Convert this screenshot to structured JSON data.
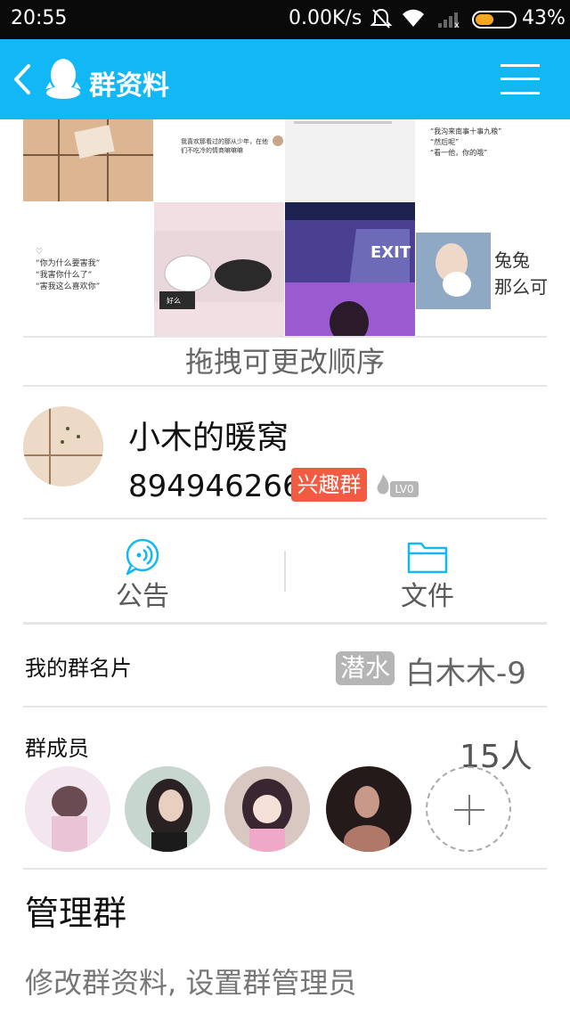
{
  "status_bar": {
    "time": "20:55",
    "net_speed": "0.00K/s",
    "battery_pct": "43%",
    "battery_level": 0.43
  },
  "title_bar": {
    "title": "群资料",
    "back_icon": "chevron-left-icon",
    "logo_icon": "qq-penguin-icon",
    "menu_icon": "hamburger-menu-icon"
  },
  "gallery": {
    "captions": [
      "",
      "我喜欢那看过的那从少年，在他\n们不吃冷的情商嘛嘛嘛",
      "",
      "“我沟来南事十事九粮”\n“然后呢”\n“看一他，你的哦”",
      "♡\n“你为什么要害我”\n“我害你什么了”\n“害我这么喜欢你”",
      "好么",
      "EXIT",
      "兔兔\n那么可"
    ]
  },
  "drag_hint": "拖拽可更改顺序",
  "group": {
    "name": "小木的暖窝",
    "id": "894946266",
    "tag": "兴趣群",
    "level": "LV0"
  },
  "actions": {
    "notice_label": "公告",
    "file_label": "文件"
  },
  "my_card": {
    "label": "我的群名片",
    "tag": "潜水",
    "nickname": "白木木-9"
  },
  "members": {
    "label": "群成员",
    "count": "15人"
  },
  "manage": {
    "title": "管理群",
    "description": "修改群资料, 设置群管理员"
  },
  "colors": {
    "title_bar": "#12b7f5",
    "interest_tag": "#f25b41",
    "icon_blue": "#12b7f5"
  }
}
